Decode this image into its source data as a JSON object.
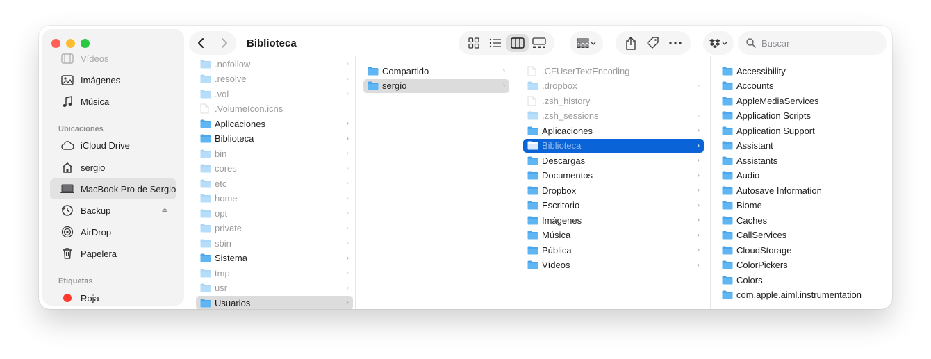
{
  "window": {
    "title": "Biblioteca"
  },
  "sidebar": {
    "favorites": [
      {
        "label": "Vídeos",
        "icon": "film-icon"
      },
      {
        "label": "Imágenes",
        "icon": "photo-icon"
      },
      {
        "label": "Música",
        "icon": "music-note-icon"
      }
    ],
    "locations_header": "Ubicaciones",
    "locations": [
      {
        "label": "iCloud Drive",
        "icon": "cloud-icon"
      },
      {
        "label": "sergio",
        "icon": "house-icon"
      },
      {
        "label": "MacBook Pro de Sergio",
        "icon": "laptop-icon",
        "selected": true
      },
      {
        "label": "Backup",
        "icon": "clock-arrow-icon",
        "eject": "⏏"
      },
      {
        "label": "AirDrop",
        "icon": "airdrop-icon"
      },
      {
        "label": "Papelera",
        "icon": "trash-icon"
      }
    ],
    "tags_header": "Etiquetas",
    "tags": [
      {
        "label": "Roja",
        "color": "#ff3b30"
      }
    ]
  },
  "toolbar": {
    "back": "‹",
    "forward": "›",
    "search_placeholder": "Buscar",
    "accent": "#0a64d8"
  },
  "columns": {
    "c1": [
      {
        "name": ".nofollow",
        "hidden": true,
        "chev": true
      },
      {
        "name": ".resolve",
        "hidden": true,
        "chev": true
      },
      {
        "name": ".vol",
        "hidden": true,
        "chev": true
      },
      {
        "name": ".VolumeIcon.icns",
        "hidden": true,
        "file": true
      },
      {
        "name": "Aplicaciones",
        "chev": true
      },
      {
        "name": "Biblioteca",
        "chev": true
      },
      {
        "name": "bin",
        "hidden": true,
        "chev": true
      },
      {
        "name": "cores",
        "hidden": true,
        "chev": true
      },
      {
        "name": "etc",
        "hidden": true,
        "chev": true
      },
      {
        "name": "home",
        "hidden": true,
        "chev": true
      },
      {
        "name": "opt",
        "hidden": true,
        "chev": true
      },
      {
        "name": "private",
        "hidden": true,
        "chev": true
      },
      {
        "name": "sbin",
        "hidden": true,
        "chev": true
      },
      {
        "name": "Sistema",
        "chev": true
      },
      {
        "name": "tmp",
        "hidden": true,
        "chev": true
      },
      {
        "name": "usr",
        "hidden": true,
        "chev": true
      },
      {
        "name": "Usuarios",
        "chev": true,
        "selected": "gray"
      }
    ],
    "c2": [
      {
        "name": "Compartido",
        "chev": true
      },
      {
        "name": "sergio",
        "chev": true,
        "selected": "gray"
      }
    ],
    "c3": [
      {
        "name": ".CFUserTextEncoding",
        "hidden": true,
        "file": true
      },
      {
        "name": ".dropbox",
        "hidden": true,
        "chev": true
      },
      {
        "name": ".zsh_history",
        "hidden": true,
        "file": true
      },
      {
        "name": ".zsh_sessions",
        "hidden": true,
        "chev": true
      },
      {
        "name": "Aplicaciones",
        "chev": true
      },
      {
        "name": "Biblioteca",
        "chev": true,
        "selected": "blue"
      },
      {
        "name": "Descargas",
        "chev": true
      },
      {
        "name": "Documentos",
        "chev": true
      },
      {
        "name": "Dropbox",
        "chev": true
      },
      {
        "name": "Escritorio",
        "chev": true
      },
      {
        "name": "Imágenes",
        "chev": true
      },
      {
        "name": "Música",
        "chev": true
      },
      {
        "name": "Pública",
        "chev": true
      },
      {
        "name": "Vídeos",
        "chev": true
      }
    ],
    "c4": [
      {
        "name": "Accessibility"
      },
      {
        "name": "Accounts"
      },
      {
        "name": "AppleMediaServices"
      },
      {
        "name": "Application Scripts"
      },
      {
        "name": "Application Support"
      },
      {
        "name": "Assistant"
      },
      {
        "name": "Assistants"
      },
      {
        "name": "Audio"
      },
      {
        "name": "Autosave Information"
      },
      {
        "name": "Biome"
      },
      {
        "name": "Caches"
      },
      {
        "name": "CallServices"
      },
      {
        "name": "CloudStorage"
      },
      {
        "name": "ColorPickers"
      },
      {
        "name": "Colors"
      },
      {
        "name": "com.apple.aiml.instrumentation"
      }
    ]
  }
}
